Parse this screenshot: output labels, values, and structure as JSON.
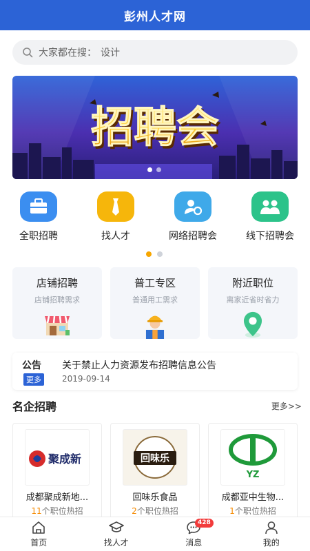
{
  "header": {
    "title": "彭州人才网"
  },
  "search": {
    "label": "大家都在搜：",
    "keyword": "设计"
  },
  "banner": {
    "text": "招聘会"
  },
  "quick_nav": {
    "items": [
      {
        "label": "全职招聘",
        "icon": "briefcase-icon",
        "color": "#3b8ef0"
      },
      {
        "label": "找人才",
        "icon": "tie-icon",
        "color": "#f6b60b"
      },
      {
        "label": "网络招聘会",
        "icon": "online-fair-icon",
        "color": "#3fa9e9"
      },
      {
        "label": "线下招聘会",
        "icon": "people-icon",
        "color": "#2cc38a"
      }
    ]
  },
  "cards": [
    {
      "title": "店铺招聘",
      "subtitle": "店铺招聘需求"
    },
    {
      "title": "普工专区",
      "subtitle": "普通用工需求"
    },
    {
      "title": "附近职位",
      "subtitle": "离家近省时省力"
    }
  ],
  "notice": {
    "tag": "公告",
    "more": "更多",
    "text": "关于禁止人力资源发布招聘信息公告",
    "date": "2019-09-14"
  },
  "famous": {
    "title": "名企招聘",
    "more": "更多>>",
    "companies": [
      {
        "name": "成都聚成新地...",
        "logo_text": "聚成新",
        "count": "11",
        "suffix": "个职位热招"
      },
      {
        "name": "回味乐食品",
        "logo_text": "回味乐",
        "count": "2",
        "suffix": "个职位热招"
      },
      {
        "name": "成都亚中生物...",
        "logo_text": "YZ",
        "count": "1",
        "suffix": "个职位热招"
      }
    ]
  },
  "tabbar": {
    "items": [
      {
        "label": "首页"
      },
      {
        "label": "找人才"
      },
      {
        "label": "消息",
        "badge": "428"
      },
      {
        "label": "我的"
      }
    ]
  },
  "colors": {
    "primary": "#2c63d6",
    "accent": "#f7a600",
    "badge": "#f23b3b"
  }
}
